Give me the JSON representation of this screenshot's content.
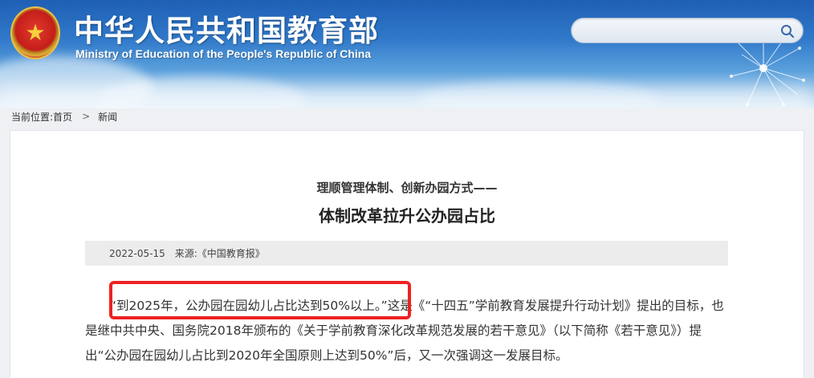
{
  "header": {
    "site_name_cn": "中华人民共和国教育部",
    "site_name_en": "Ministry of Education of the People's Republic of China",
    "search": {
      "value": "",
      "placeholder": ""
    },
    "colors": {
      "sky": "#2f78c9",
      "emblem_red": "#c41e1a",
      "emblem_gold": "#e0b33a"
    }
  },
  "breadcrumb": {
    "label": "当前位置:",
    "home": "首页",
    "separator": ">",
    "current": "新闻"
  },
  "article": {
    "subtitle": "理顺管理体制、创新办园方式——",
    "title": "体制改革拉升公办园占比",
    "date": "2022-05-15",
    "source": "来源:《中国教育报》",
    "paragraph": "“到2025年，公办园在园幼儿占比达到50%以上。”这是《“十四五”学前教育发展提升行动计划》提出的目标，也是继中共中央、国务院2018年颁布的《关于学前教育深化改革规范发展的若干意见》（以下简称《若干意见》）提出“公办园在园幼儿占比到2020年全国原则上达到50%”后，又一次强调这一发展目标。"
  },
  "annotation": {
    "highlight_color": "#ee2222"
  }
}
